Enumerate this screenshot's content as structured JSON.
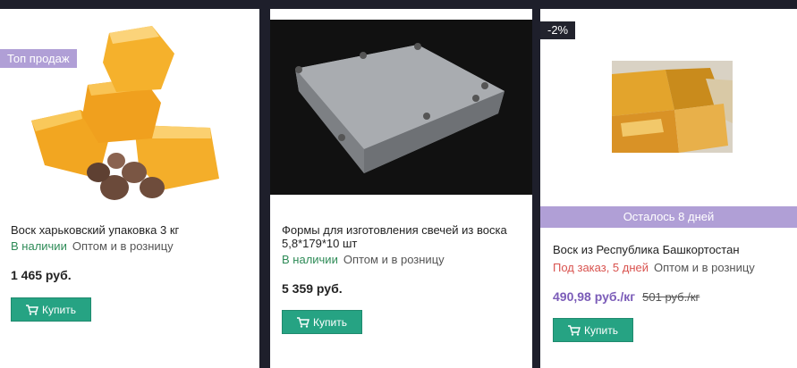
{
  "products": [
    {
      "badge": "Топ продаж",
      "title": "Воск харьковский упаковка 3 кг",
      "availability": "В наличии",
      "sale_mode": "Оптом и в розницу",
      "price": "1 465 руб.",
      "buy_label": "Купить"
    },
    {
      "title": "Формы для изготовления свечей из воска 5,8*179*10 шт",
      "availability": "В наличии",
      "sale_mode": "Оптом и в розницу",
      "price": "5 359 руб.",
      "buy_label": "Купить"
    },
    {
      "discount": "-2%",
      "remaining": "Осталось 8 дней",
      "title": "Воск из Республика Башкортостан",
      "availability": "Под заказ, 5 дней",
      "sale_mode": "Оптом и в розницу",
      "price": "490,98 руб./кг",
      "old_price": "501 руб./кг",
      "buy_label": "Купить"
    }
  ],
  "colors": {
    "accent_purple": "#b09fd6",
    "buy_green": "#26a383",
    "in_stock_green": "#2e8b57",
    "on_order_red": "#d9534f",
    "price_purple": "#7b5cb8"
  }
}
